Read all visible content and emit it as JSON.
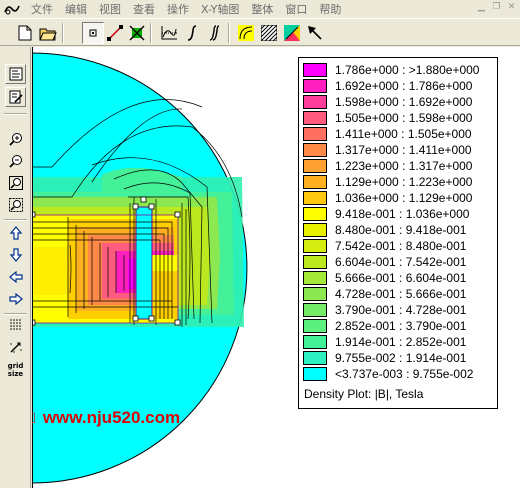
{
  "menu": {
    "items": [
      "文件",
      "编辑",
      "视图",
      "查看",
      "操作",
      "X-Y轴图",
      "整体",
      "窗口",
      "帮助"
    ]
  },
  "window_controls": [
    "minimize-icon",
    "restore-icon",
    "close-icon"
  ],
  "toolbar": {
    "buttons": [
      "new-file-icon",
      "open-folder-icon",
      "select-node-icon",
      "select-line-icon",
      "select-area-icon",
      "xy-plot-icon",
      "line-integral-icon",
      "block-integral-icon",
      "contour-icon",
      "density-icon",
      "vector-icon",
      "pointer-icon"
    ]
  },
  "left_toolbar": {
    "buttons": [
      "list-icon",
      "edit-list-icon",
      "zoom-in-icon",
      "zoom-out-icon",
      "zoom-fit-icon",
      "zoom-window-icon",
      "pan-up-icon",
      "pan-down-icon",
      "pan-left-icon",
      "pan-right-icon",
      "grid-icon",
      "snap-icon",
      "grid-size-icon"
    ],
    "grid_size_label": [
      "grid",
      "size"
    ]
  },
  "legend": {
    "title": "Density Plot: |B|, Tesla",
    "rows": [
      {
        "label": "1.786e+000 : >1.880e+000",
        "color": "#ff00ff"
      },
      {
        "label": "1.692e+000 : 1.786e+000",
        "color": "#ff1fbf"
      },
      {
        "label": "1.598e+000 : 1.692e+000",
        "color": "#ff3d9a"
      },
      {
        "label": "1.505e+000 : 1.598e+000",
        "color": "#ff5c80"
      },
      {
        "label": "1.411e+000 : 1.505e+000",
        "color": "#ff7060"
      },
      {
        "label": "1.317e+000 : 1.411e+000",
        "color": "#ff8a48"
      },
      {
        "label": "1.223e+000 : 1.317e+000",
        "color": "#ffa030"
      },
      {
        "label": "1.129e+000 : 1.223e+000",
        "color": "#ffb020"
      },
      {
        "label": "1.036e+000 : 1.129e+000",
        "color": "#ffc810"
      },
      {
        "label": "9.418e-001 : 1.036e+000",
        "color": "#ffff00"
      },
      {
        "label": "8.480e-001 : 9.418e-001",
        "color": "#e8f000"
      },
      {
        "label": "7.542e-001 : 8.480e-001",
        "color": "#d4ec10"
      },
      {
        "label": "6.604e-001 : 7.542e-001",
        "color": "#bce820"
      },
      {
        "label": "5.666e-001 : 6.604e-001",
        "color": "#a4e838"
      },
      {
        "label": "4.728e-001 : 5.666e-001",
        "color": "#8ce850"
      },
      {
        "label": "3.790e-001 : 4.728e-001",
        "color": "#74ec68"
      },
      {
        "label": "2.852e-001 : 3.790e-001",
        "color": "#5cf080"
      },
      {
        "label": "1.914e-001 : 2.852e-001",
        "color": "#44f098"
      },
      {
        "label": "9.755e-002 : 1.914e-001",
        "color": "#2cf0c0"
      },
      {
        "label": "<3.737e-003 : 9.755e-002",
        "color": "#00ffff"
      }
    ]
  },
  "watermark": {
    "boxes": "□□□",
    "url": "www.nju520.com"
  }
}
